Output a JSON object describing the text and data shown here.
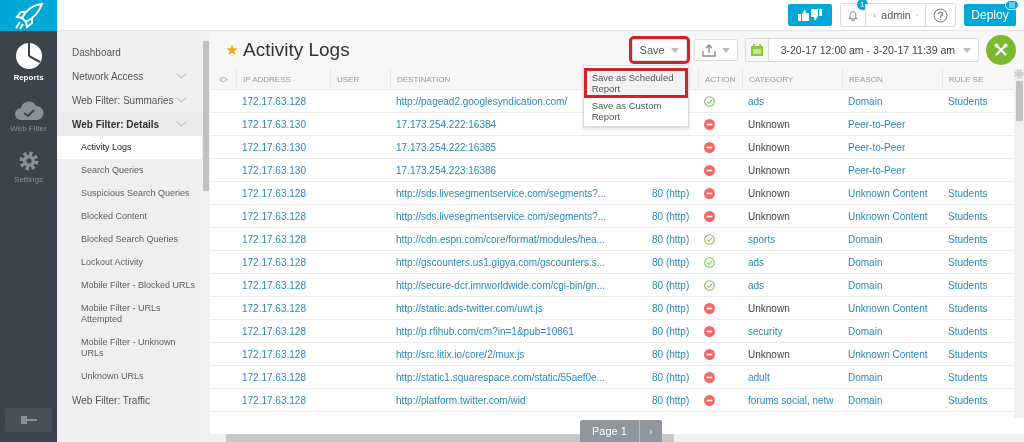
{
  "rail": {
    "items": [
      {
        "label": "Reports",
        "selected": true
      },
      {
        "label": "Web Filter",
        "selected": false
      },
      {
        "label": "Settings",
        "selected": false
      }
    ]
  },
  "topbar": {
    "notifications": "1",
    "user": "admin",
    "deploy": "Deploy"
  },
  "sidebar": {
    "items": [
      {
        "label": "Dashboard",
        "expandable": false,
        "expanded": false
      },
      {
        "label": "Network Access",
        "expandable": true,
        "expanded": false
      },
      {
        "label": "Web Filter: Summaries",
        "expandable": true,
        "expanded": false
      },
      {
        "label": "Web Filter: Details",
        "expandable": true,
        "expanded": true,
        "children": [
          {
            "label": "Activity Logs",
            "selected": true
          },
          {
            "label": "Search Queries",
            "selected": false
          },
          {
            "label": "Suspicious Search Queries",
            "selected": false
          },
          {
            "label": "Blocked Content",
            "selected": false
          },
          {
            "label": "Blocked Search Queries",
            "selected": false
          },
          {
            "label": "Lockout Activity",
            "selected": false
          },
          {
            "label": "Mobile Filter - Blocked URLs",
            "selected": false
          },
          {
            "label": "Mobile Filter - URLs Attempted",
            "selected": false
          },
          {
            "label": "Mobile Filter - Unknown URLs",
            "selected": false
          },
          {
            "label": "Unknown URLs",
            "selected": false
          }
        ]
      },
      {
        "label": "Web Filter: Traffic",
        "expandable": false,
        "expanded": false
      }
    ]
  },
  "page": {
    "title": "Activity Logs",
    "favorite": true,
    "save": {
      "label": "Save",
      "highlighted": true,
      "menu": [
        {
          "label": "Save as Scheduled Report",
          "selected": true
        },
        {
          "label": "Save as Custom Report",
          "selected": false
        }
      ]
    },
    "date_range": "3-20-17 12:00 am - 3-20-17 11:39 am"
  },
  "table": {
    "columns": [
      "IP ADDRESS",
      "USER",
      "DESTINATION",
      "ACTION",
      "CATEGORY",
      "REASON",
      "RULE SE"
    ],
    "rows": [
      {
        "ip": "172.17.63.128",
        "destination": "http://pagead2.googlesyndication.com/",
        "blocked": false,
        "category": "ads",
        "linked": true,
        "reason": "Domain",
        "rule_set": "Students"
      },
      {
        "ip": "172.17.63.130",
        "destination": "17.173.254.222:16384",
        "blocked": true,
        "category": "Unknown",
        "linked": false,
        "reason": "Peer-to-Peer"
      },
      {
        "ip": "172.17.63.130",
        "destination": "17.173.254.222:16385",
        "blocked": true,
        "category": "Unknown",
        "linked": false,
        "reason": "Peer-to-Peer"
      },
      {
        "ip": "172.17.63.130",
        "destination": "17.173.254.223:16386",
        "blocked": true,
        "category": "Unknown",
        "linked": false,
        "reason": "Peer-to-Peer"
      },
      {
        "ip": "172.17.63.128",
        "destination": "http://sds.livesegmentservice.com/segments?...",
        "port": "80 (http)",
        "blocked": true,
        "category": "Unknown",
        "linked": false,
        "reason": "Unknown Content",
        "rule_set": "Students"
      },
      {
        "ip": "172.17.63.128",
        "destination": "http://sds.livesegmentservice.com/segments?...",
        "port": "80 (http)",
        "blocked": true,
        "category": "Unknown",
        "linked": false,
        "reason": "Unknown Content",
        "rule_set": "Students"
      },
      {
        "ip": "172.17.63.128",
        "destination": "http://cdn.espn.com/core/format/modules/hea...",
        "port": "80 (http)",
        "blocked": false,
        "category": "sports",
        "linked": true,
        "reason": "Domain",
        "rule_set": "Students"
      },
      {
        "ip": "172.17.63.128",
        "destination": "http://gscounters.us1.gigya.com/gscounters.s...",
        "port": "80 (http)",
        "blocked": false,
        "category": "ads",
        "linked": true,
        "reason": "Domain",
        "rule_set": "Students"
      },
      {
        "ip": "172.17.63.128",
        "destination": "http://secure-dcr.imrworldwide.com/cgi-bin/gn...",
        "port": "80 (http)",
        "blocked": false,
        "category": "ads",
        "linked": true,
        "reason": "Domain",
        "rule_set": "Students"
      },
      {
        "ip": "172.17.63.128",
        "destination": "http://static.ads-twitter.com/uwt.js",
        "port": "80 (http)",
        "blocked": true,
        "category": "Unknown",
        "linked": false,
        "reason": "Unknown Content",
        "rule_set": "Students"
      },
      {
        "ip": "172.17.63.128",
        "destination": "http://p.rfihub.com/cm?in=1&pub=10861",
        "port": "80 (http)",
        "blocked": true,
        "category": "security",
        "linked": true,
        "reason": "Domain",
        "rule_set": "Students"
      },
      {
        "ip": "172.17.63.128",
        "destination": "http://src.litix.io/core/2/mux.js",
        "port": "80 (http)",
        "blocked": true,
        "category": "Unknown",
        "linked": false,
        "reason": "Unknown Content",
        "rule_set": "Students"
      },
      {
        "ip": "172.17.63.128",
        "destination": "http://static1.squarespace.com/static/55aef0e...",
        "port": "80 (http)",
        "blocked": true,
        "category": "adult",
        "linked": true,
        "reason": "Domain",
        "rule_set": "Students"
      },
      {
        "ip": "172.17.63.128",
        "destination": "http://platform.twitter.com/wid",
        "port": "80 (http)",
        "blocked": true,
        "category": "forums social, netw",
        "linked": true,
        "reason": "Domain",
        "rule_set": "Students"
      }
    ]
  },
  "pager": {
    "label": "Page 1",
    "next": "›"
  }
}
